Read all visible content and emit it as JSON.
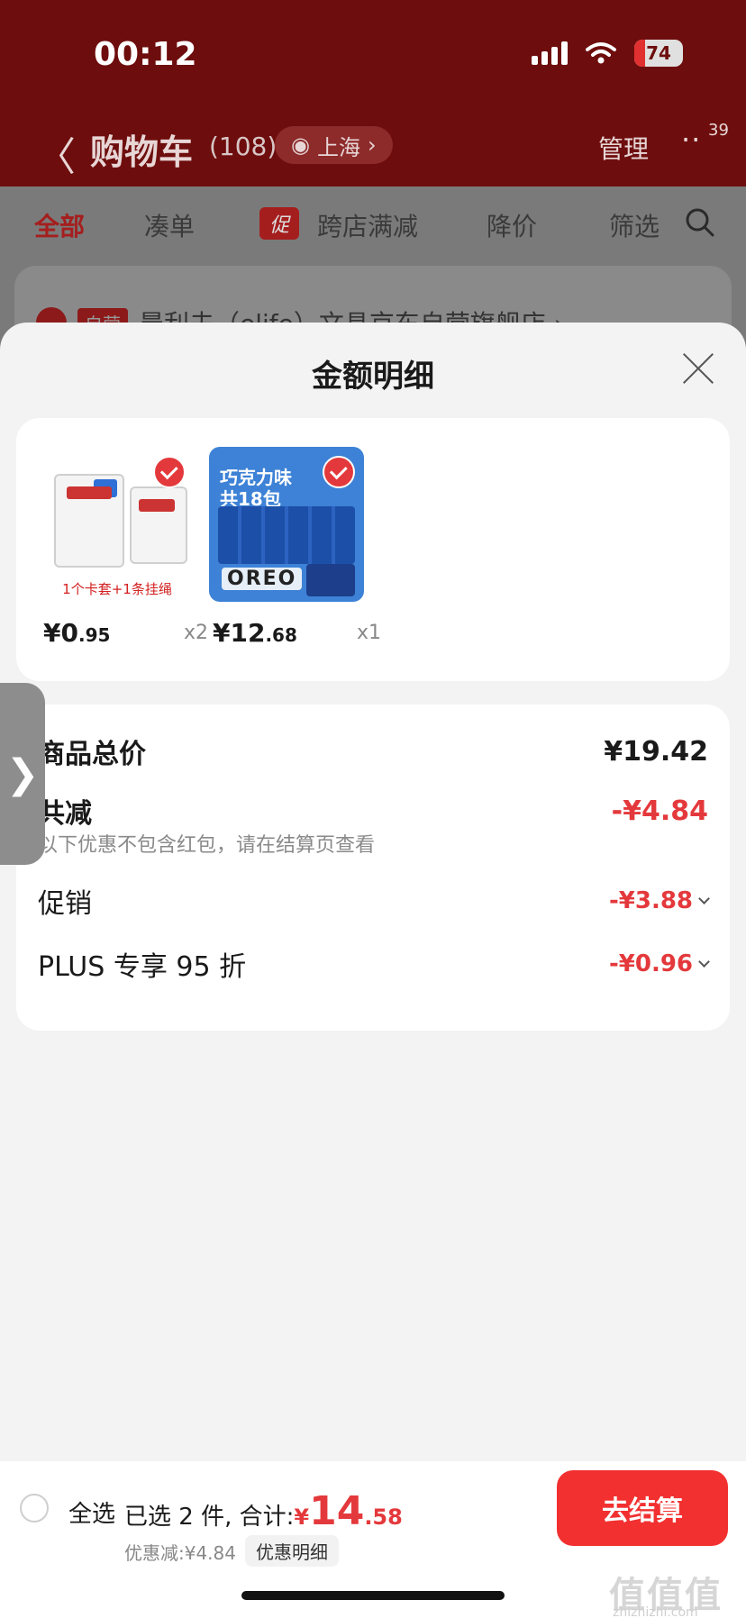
{
  "status_bar": {
    "time": "00:12",
    "battery": "74"
  },
  "nav": {
    "back": "〈",
    "title": "购物车",
    "count": "(108)",
    "location": "上海",
    "manage": "管理",
    "more": "··",
    "badge": "39"
  },
  "tabs": {
    "all": "全部",
    "bundle": "凑单",
    "promo_badge": "促",
    "cross_store": "跨店满减",
    "price_drop": "降价",
    "filter": "筛选"
  },
  "store": {
    "tag": "自营",
    "name": "晨利夫（elife）文具京东自营旗舰店 ›"
  },
  "sheet": {
    "title": "金额明细",
    "products": [
      {
        "caption": "1个卡套+1条挂绳",
        "price_int": "¥0",
        "price_dec": ".95",
        "qty": "x2"
      },
      {
        "title_line1": "巧克力味",
        "title_line2": "共18包",
        "logo": "OREO",
        "price_int": "¥12",
        "price_dec": ".68",
        "qty": "x1"
      }
    ],
    "summary": {
      "total_label": "商品总价",
      "total_value": "¥19.42",
      "reduce_label": "共减",
      "reduce_value": "-¥4.84",
      "note": "以下优惠不包含红包，请在结算页查看",
      "promo_label": "促销",
      "promo_value": "-¥3.88",
      "plus_label": "PLUS 专享 95 折",
      "plus_value": "-¥0.96"
    },
    "side_handle": "❯"
  },
  "bottom_bar": {
    "select_all": "全选",
    "selected": "已选 2 件, 合计: ",
    "total_yen": "¥",
    "total_int": "14",
    "total_dec": ".58",
    "discount": "优惠减:¥4.84",
    "detail_chip": "优惠明细",
    "checkout": "去结算",
    "watermark": "值值值",
    "watermark_sub": "zhizhizhi.com"
  }
}
